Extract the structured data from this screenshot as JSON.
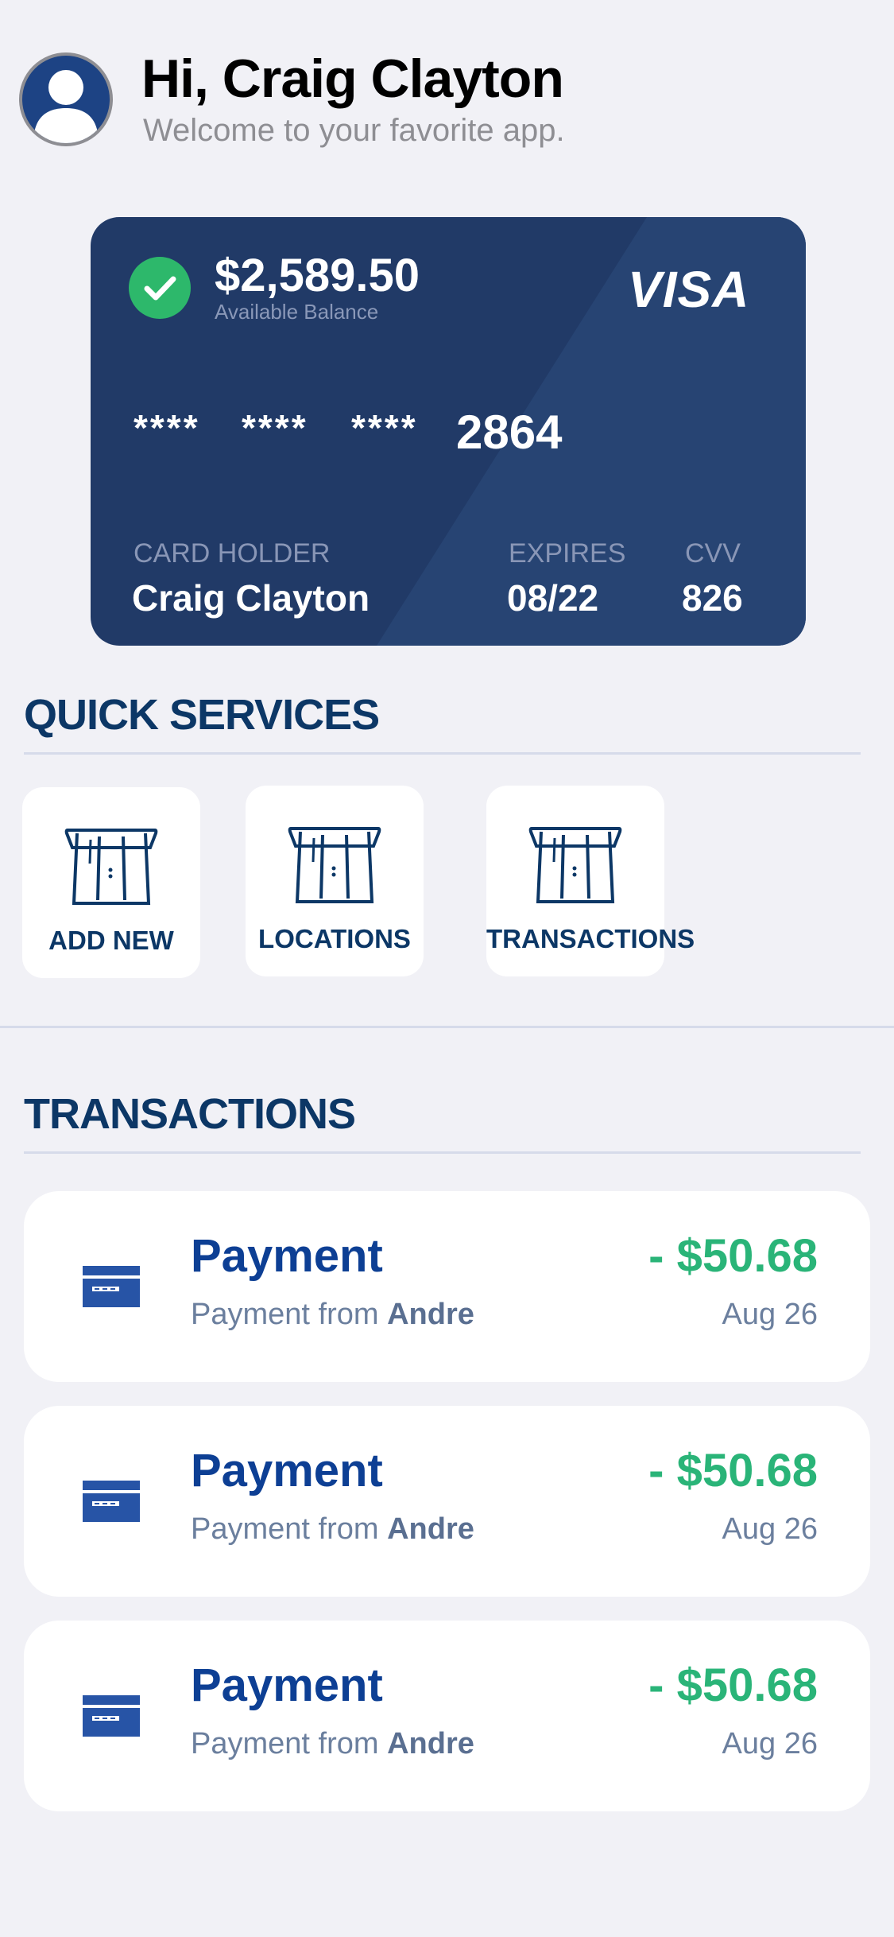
{
  "header": {
    "greeting": "Hi, Craig Clayton",
    "subtitle": "Welcome to your favorite app."
  },
  "card": {
    "balance": "$2,589.50",
    "balance_label": "Available Balance",
    "brand": "VISA",
    "masked_groups": [
      "****",
      "****",
      "****"
    ],
    "last4": "2864",
    "holder_label": "CARD HOLDER",
    "holder_name": "Craig Clayton",
    "expires_label": "EXPIRES",
    "expires": "08/22",
    "cvv_label": "CVV",
    "cvv": "826",
    "colors": {
      "background": "#213a67",
      "check": "#2db86b"
    }
  },
  "quick_services": {
    "title": "QUICK SERVICES",
    "items": [
      {
        "label": "ADD NEW",
        "icon": "card-slot-icon"
      },
      {
        "label": "LOCATIONS",
        "icon": "card-slot-icon"
      },
      {
        "label": "TRANSACTIONS",
        "icon": "card-slot-icon"
      }
    ]
  },
  "transactions": {
    "title": "TRANSACTIONS",
    "items": [
      {
        "title": "Payment",
        "from_prefix": "Payment from",
        "from_name": "Andre",
        "amount": "- $50.68",
        "date": "Aug 26",
        "icon": "credit-card-icon"
      },
      {
        "title": "Payment",
        "from_prefix": "Payment from",
        "from_name": "Andre",
        "amount": "- $50.68",
        "date": "Aug 26",
        "icon": "credit-card-icon"
      },
      {
        "title": "Payment",
        "from_prefix": "Payment from",
        "from_name": "Andre",
        "amount": "- $50.68",
        "date": "Aug 26",
        "icon": "credit-card-icon"
      }
    ]
  },
  "colors": {
    "background": "#f1f1f6",
    "navy": "#0c3766",
    "payment_title": "#0d3f94",
    "amount_green": "#2ab478"
  }
}
